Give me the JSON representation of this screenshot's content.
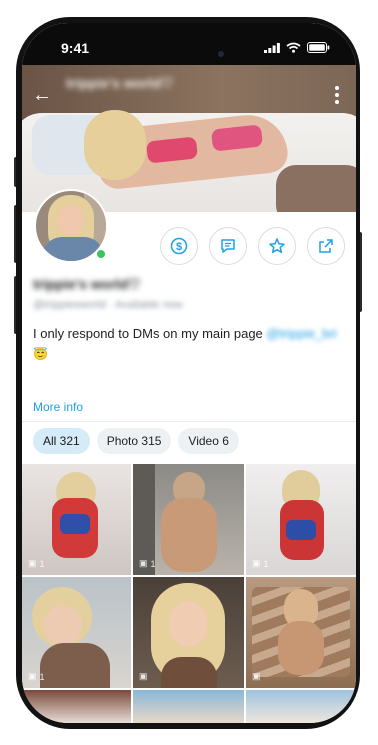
{
  "status_bar": {
    "time": "9:41"
  },
  "profile": {
    "display_name": "trippie's world♡",
    "handle": "@trippiesworld",
    "availability": "Available now",
    "bio_text": "I only respond to DMs on my main page ",
    "bio_link": "@trippie_bri",
    "bio_emoji": "😇",
    "more_info": "More info",
    "online": true
  },
  "actions": [
    {
      "icon": "dollar-icon"
    },
    {
      "icon": "message-icon"
    },
    {
      "icon": "star-icon"
    },
    {
      "icon": "share-icon"
    }
  ],
  "filters": [
    {
      "label": "All 321",
      "active": true
    },
    {
      "label": "Photo 315",
      "active": false
    },
    {
      "label": "Video 6",
      "active": false
    }
  ],
  "media": {
    "tiles": [
      {
        "count": "1"
      },
      {
        "count": "1"
      },
      {
        "count": "1"
      },
      {
        "count": "1"
      },
      {
        "count": ""
      },
      {
        "count": ""
      }
    ]
  },
  "colors": {
    "accent": "#1ea1e6",
    "online": "#3bc55e",
    "chip_active": "#d6ebf8"
  }
}
